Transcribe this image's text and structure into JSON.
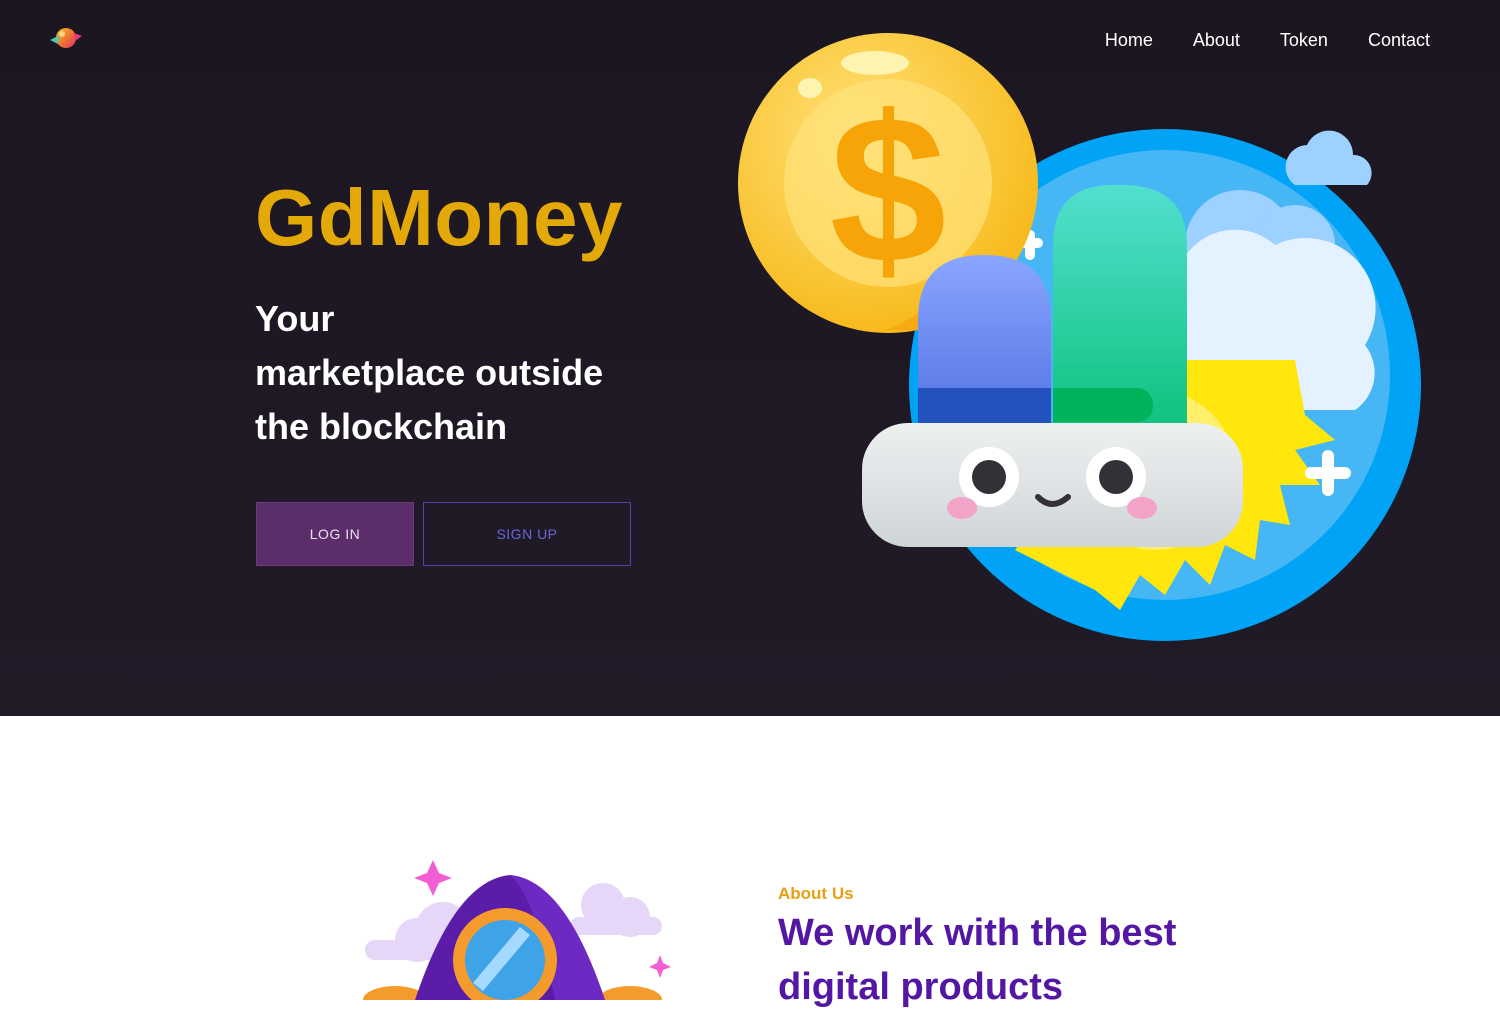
{
  "nav": {
    "items": [
      "Home",
      "About",
      "Token",
      "Contact"
    ]
  },
  "hero": {
    "brand": "GdMoney",
    "tagline_lines": [
      "Your",
      "marketplace outside",
      "the blockchain"
    ],
    "login_label": "LOG IN",
    "signup_label": "SIGN UP",
    "illustration": "coin-and-bar-chart-mascot"
  },
  "about": {
    "kicker": "About Us",
    "title_lines": [
      "We work with the best",
      "digital products"
    ],
    "illustration": "rocket"
  },
  "colors": {
    "hero_bg": "#1c1722",
    "brand": "#e3a908",
    "login_bg": "#5b2d6b",
    "signup_border": "#4b46a8",
    "about_kicker": "#e8a012",
    "about_title": "#5417a4"
  }
}
